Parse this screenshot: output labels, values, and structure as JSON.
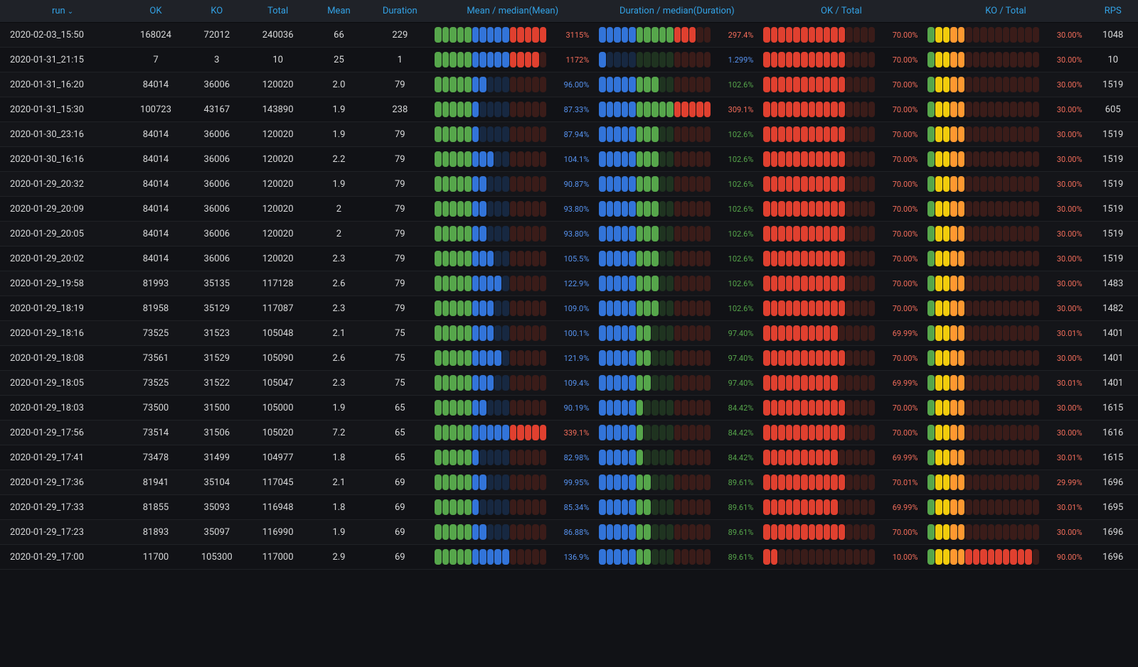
{
  "columns": {
    "run": "run",
    "ok": "OK",
    "ko": "KO",
    "total": "Total",
    "mean": "Mean",
    "duration": "Duration",
    "mean_median": "Mean / median(Mean)",
    "duration_median": "Duration / median(Duration)",
    "ok_total": "OK / Total",
    "ko_total": "KO / Total",
    "rps": "RPS"
  },
  "sort": {
    "column": "run",
    "dir": "desc",
    "caret": "⌄"
  },
  "colors": {
    "green_on": "#56a64b",
    "green_off": "#1f3320",
    "blue_on": "#3274d9",
    "blue_off": "#172841",
    "red_on": "#e0402f",
    "red_off": "#3a1c19",
    "yellow_on": "#f2cc0c",
    "orange_on": "#ff9830"
  },
  "gauges": {
    "mean_median": {
      "sections": [
        {
          "color": "green",
          "count": 5
        },
        {
          "color": "blue",
          "count": 5
        },
        {
          "color": "red",
          "count": 5
        }
      ]
    },
    "duration_median": {
      "sections": [
        {
          "color": "blue",
          "count": 5
        },
        {
          "color": "green",
          "count": 5
        },
        {
          "color": "red",
          "count": 5
        }
      ]
    },
    "ok_total": {
      "sections": [
        {
          "color": "red",
          "count": 15
        }
      ]
    },
    "ko_total": {
      "sections": [
        {
          "color": "green",
          "count": 1
        },
        {
          "color": "yellow",
          "count": 2
        },
        {
          "color": "orange",
          "count": 2
        },
        {
          "color": "red",
          "count": 10
        }
      ]
    }
  },
  "rows": [
    {
      "run": "2020-02-03_15:50",
      "ok": "168024",
      "ko": "72012",
      "total": "240036",
      "mean": "66",
      "duration": "229",
      "mean_median": {
        "pct": "3115%",
        "filled": 15,
        "cls": "pct-red"
      },
      "duration_median": {
        "pct": "297.4%",
        "filled": 13,
        "cls": "pct-red"
      },
      "ok_total": {
        "pct": "70.00%",
        "filled": 11,
        "cls": "pct-red"
      },
      "ko_total": {
        "pct": "30.00%",
        "filled": 5,
        "cls": "pct-red"
      },
      "rps": "1048"
    },
    {
      "run": "2020-01-31_21:15",
      "ok": "7",
      "ko": "3",
      "total": "10",
      "mean": "25",
      "duration": "1",
      "mean_median": {
        "pct": "1172%",
        "filled": 14,
        "cls": "pct-red"
      },
      "duration_median": {
        "pct": "1.299%",
        "filled": 1,
        "cls": "pct-blue"
      },
      "ok_total": {
        "pct": "70.00%",
        "filled": 11,
        "cls": "pct-red"
      },
      "ko_total": {
        "pct": "30.00%",
        "filled": 5,
        "cls": "pct-red"
      },
      "rps": "10"
    },
    {
      "run": "2020-01-31_16:20",
      "ok": "84014",
      "ko": "36006",
      "total": "120020",
      "mean": "2.0",
      "duration": "79",
      "mean_median": {
        "pct": "96.00%",
        "filled": 7,
        "cls": "pct-blue"
      },
      "duration_median": {
        "pct": "102.6%",
        "filled": 8,
        "cls": "pct-green"
      },
      "ok_total": {
        "pct": "70.00%",
        "filled": 11,
        "cls": "pct-red"
      },
      "ko_total": {
        "pct": "30.00%",
        "filled": 5,
        "cls": "pct-red"
      },
      "rps": "1519"
    },
    {
      "run": "2020-01-31_15:30",
      "ok": "100723",
      "ko": "43167",
      "total": "143890",
      "mean": "1.9",
      "duration": "238",
      "mean_median": {
        "pct": "87.33%",
        "filled": 6,
        "cls": "pct-blue"
      },
      "duration_median": {
        "pct": "309.1%",
        "filled": 15,
        "cls": "pct-red"
      },
      "ok_total": {
        "pct": "70.00%",
        "filled": 11,
        "cls": "pct-red"
      },
      "ko_total": {
        "pct": "30.00%",
        "filled": 5,
        "cls": "pct-red"
      },
      "rps": "605"
    },
    {
      "run": "2020-01-30_23:16",
      "ok": "84014",
      "ko": "36006",
      "total": "120020",
      "mean": "1.9",
      "duration": "79",
      "mean_median": {
        "pct": "87.94%",
        "filled": 6,
        "cls": "pct-blue"
      },
      "duration_median": {
        "pct": "102.6%",
        "filled": 8,
        "cls": "pct-green"
      },
      "ok_total": {
        "pct": "70.00%",
        "filled": 11,
        "cls": "pct-red"
      },
      "ko_total": {
        "pct": "30.00%",
        "filled": 5,
        "cls": "pct-red"
      },
      "rps": "1519"
    },
    {
      "run": "2020-01-30_16:16",
      "ok": "84014",
      "ko": "36006",
      "total": "120020",
      "mean": "2.2",
      "duration": "79",
      "mean_median": {
        "pct": "104.1%",
        "filled": 8,
        "cls": "pct-blue"
      },
      "duration_median": {
        "pct": "102.6%",
        "filled": 8,
        "cls": "pct-green"
      },
      "ok_total": {
        "pct": "70.00%",
        "filled": 11,
        "cls": "pct-red"
      },
      "ko_total": {
        "pct": "30.00%",
        "filled": 5,
        "cls": "pct-red"
      },
      "rps": "1519"
    },
    {
      "run": "2020-01-29_20:32",
      "ok": "84014",
      "ko": "36006",
      "total": "120020",
      "mean": "1.9",
      "duration": "79",
      "mean_median": {
        "pct": "90.87%",
        "filled": 7,
        "cls": "pct-blue"
      },
      "duration_median": {
        "pct": "102.6%",
        "filled": 8,
        "cls": "pct-green"
      },
      "ok_total": {
        "pct": "70.00%",
        "filled": 11,
        "cls": "pct-red"
      },
      "ko_total": {
        "pct": "30.00%",
        "filled": 5,
        "cls": "pct-red"
      },
      "rps": "1519"
    },
    {
      "run": "2020-01-29_20:09",
      "ok": "84014",
      "ko": "36006",
      "total": "120020",
      "mean": "2",
      "duration": "79",
      "mean_median": {
        "pct": "93.80%",
        "filled": 7,
        "cls": "pct-blue"
      },
      "duration_median": {
        "pct": "102.6%",
        "filled": 8,
        "cls": "pct-green"
      },
      "ok_total": {
        "pct": "70.00%",
        "filled": 11,
        "cls": "pct-red"
      },
      "ko_total": {
        "pct": "30.00%",
        "filled": 5,
        "cls": "pct-red"
      },
      "rps": "1519"
    },
    {
      "run": "2020-01-29_20:05",
      "ok": "84014",
      "ko": "36006",
      "total": "120020",
      "mean": "2",
      "duration": "79",
      "mean_median": {
        "pct": "93.80%",
        "filled": 7,
        "cls": "pct-blue"
      },
      "duration_median": {
        "pct": "102.6%",
        "filled": 8,
        "cls": "pct-green"
      },
      "ok_total": {
        "pct": "70.00%",
        "filled": 11,
        "cls": "pct-red"
      },
      "ko_total": {
        "pct": "30.00%",
        "filled": 5,
        "cls": "pct-red"
      },
      "rps": "1519"
    },
    {
      "run": "2020-01-29_20:02",
      "ok": "84014",
      "ko": "36006",
      "total": "120020",
      "mean": "2.3",
      "duration": "79",
      "mean_median": {
        "pct": "105.5%",
        "filled": 8,
        "cls": "pct-blue"
      },
      "duration_median": {
        "pct": "102.6%",
        "filled": 8,
        "cls": "pct-green"
      },
      "ok_total": {
        "pct": "70.00%",
        "filled": 11,
        "cls": "pct-red"
      },
      "ko_total": {
        "pct": "30.00%",
        "filled": 5,
        "cls": "pct-red"
      },
      "rps": "1519"
    },
    {
      "run": "2020-01-29_19:58",
      "ok": "81993",
      "ko": "35135",
      "total": "117128",
      "mean": "2.6",
      "duration": "79",
      "mean_median": {
        "pct": "122.9%",
        "filled": 9,
        "cls": "pct-blue"
      },
      "duration_median": {
        "pct": "102.6%",
        "filled": 8,
        "cls": "pct-green"
      },
      "ok_total": {
        "pct": "70.00%",
        "filled": 11,
        "cls": "pct-red"
      },
      "ko_total": {
        "pct": "30.00%",
        "filled": 5,
        "cls": "pct-red"
      },
      "rps": "1483"
    },
    {
      "run": "2020-01-29_18:19",
      "ok": "81958",
      "ko": "35129",
      "total": "117087",
      "mean": "2.3",
      "duration": "79",
      "mean_median": {
        "pct": "109.0%",
        "filled": 8,
        "cls": "pct-blue"
      },
      "duration_median": {
        "pct": "102.6%",
        "filled": 8,
        "cls": "pct-green"
      },
      "ok_total": {
        "pct": "70.00%",
        "filled": 11,
        "cls": "pct-red"
      },
      "ko_total": {
        "pct": "30.00%",
        "filled": 5,
        "cls": "pct-red"
      },
      "rps": "1482"
    },
    {
      "run": "2020-01-29_18:16",
      "ok": "73525",
      "ko": "31523",
      "total": "105048",
      "mean": "2.1",
      "duration": "75",
      "mean_median": {
        "pct": "100.1%",
        "filled": 8,
        "cls": "pct-blue"
      },
      "duration_median": {
        "pct": "97.40%",
        "filled": 7,
        "cls": "pct-green"
      },
      "ok_total": {
        "pct": "69.99%",
        "filled": 10,
        "cls": "pct-red"
      },
      "ko_total": {
        "pct": "30.01%",
        "filled": 5,
        "cls": "pct-red"
      },
      "rps": "1401"
    },
    {
      "run": "2020-01-29_18:08",
      "ok": "73561",
      "ko": "31529",
      "total": "105090",
      "mean": "2.6",
      "duration": "75",
      "mean_median": {
        "pct": "121.9%",
        "filled": 9,
        "cls": "pct-blue"
      },
      "duration_median": {
        "pct": "97.40%",
        "filled": 7,
        "cls": "pct-green"
      },
      "ok_total": {
        "pct": "70.00%",
        "filled": 11,
        "cls": "pct-red"
      },
      "ko_total": {
        "pct": "30.00%",
        "filled": 5,
        "cls": "pct-red"
      },
      "rps": "1401"
    },
    {
      "run": "2020-01-29_18:05",
      "ok": "73525",
      "ko": "31522",
      "total": "105047",
      "mean": "2.3",
      "duration": "75",
      "mean_median": {
        "pct": "109.4%",
        "filled": 8,
        "cls": "pct-blue"
      },
      "duration_median": {
        "pct": "97.40%",
        "filled": 7,
        "cls": "pct-green"
      },
      "ok_total": {
        "pct": "69.99%",
        "filled": 10,
        "cls": "pct-red"
      },
      "ko_total": {
        "pct": "30.01%",
        "filled": 5,
        "cls": "pct-red"
      },
      "rps": "1401"
    },
    {
      "run": "2020-01-29_18:03",
      "ok": "73500",
      "ko": "31500",
      "total": "105000",
      "mean": "1.9",
      "duration": "65",
      "mean_median": {
        "pct": "90.19%",
        "filled": 7,
        "cls": "pct-blue"
      },
      "duration_median": {
        "pct": "84.42%",
        "filled": 6,
        "cls": "pct-green"
      },
      "ok_total": {
        "pct": "70.00%",
        "filled": 11,
        "cls": "pct-red"
      },
      "ko_total": {
        "pct": "30.00%",
        "filled": 5,
        "cls": "pct-red"
      },
      "rps": "1615"
    },
    {
      "run": "2020-01-29_17:56",
      "ok": "73514",
      "ko": "31506",
      "total": "105020",
      "mean": "7.2",
      "duration": "65",
      "mean_median": {
        "pct": "339.1%",
        "filled": 15,
        "cls": "pct-red"
      },
      "duration_median": {
        "pct": "84.42%",
        "filled": 6,
        "cls": "pct-green"
      },
      "ok_total": {
        "pct": "70.00%",
        "filled": 11,
        "cls": "pct-red"
      },
      "ko_total": {
        "pct": "30.00%",
        "filled": 5,
        "cls": "pct-red"
      },
      "rps": "1616"
    },
    {
      "run": "2020-01-29_17:41",
      "ok": "73478",
      "ko": "31499",
      "total": "104977",
      "mean": "1.8",
      "duration": "65",
      "mean_median": {
        "pct": "82.98%",
        "filled": 6,
        "cls": "pct-blue"
      },
      "duration_median": {
        "pct": "84.42%",
        "filled": 6,
        "cls": "pct-green"
      },
      "ok_total": {
        "pct": "69.99%",
        "filled": 10,
        "cls": "pct-red"
      },
      "ko_total": {
        "pct": "30.01%",
        "filled": 5,
        "cls": "pct-red"
      },
      "rps": "1615"
    },
    {
      "run": "2020-01-29_17:36",
      "ok": "81941",
      "ko": "35104",
      "total": "117045",
      "mean": "2.1",
      "duration": "69",
      "mean_median": {
        "pct": "99.95%",
        "filled": 7,
        "cls": "pct-blue"
      },
      "duration_median": {
        "pct": "89.61%",
        "filled": 7,
        "cls": "pct-green"
      },
      "ok_total": {
        "pct": "70.01%",
        "filled": 11,
        "cls": "pct-red"
      },
      "ko_total": {
        "pct": "29.99%",
        "filled": 5,
        "cls": "pct-red"
      },
      "rps": "1696"
    },
    {
      "run": "2020-01-29_17:33",
      "ok": "81855",
      "ko": "35093",
      "total": "116948",
      "mean": "1.8",
      "duration": "69",
      "mean_median": {
        "pct": "85.34%",
        "filled": 6,
        "cls": "pct-blue"
      },
      "duration_median": {
        "pct": "89.61%",
        "filled": 7,
        "cls": "pct-green"
      },
      "ok_total": {
        "pct": "69.99%",
        "filled": 10,
        "cls": "pct-red"
      },
      "ko_total": {
        "pct": "30.01%",
        "filled": 5,
        "cls": "pct-red"
      },
      "rps": "1695"
    },
    {
      "run": "2020-01-29_17:23",
      "ok": "81893",
      "ko": "35097",
      "total": "116990",
      "mean": "1.9",
      "duration": "69",
      "mean_median": {
        "pct": "86.88%",
        "filled": 7,
        "cls": "pct-blue"
      },
      "duration_median": {
        "pct": "89.61%",
        "filled": 7,
        "cls": "pct-green"
      },
      "ok_total": {
        "pct": "70.00%",
        "filled": 11,
        "cls": "pct-red"
      },
      "ko_total": {
        "pct": "30.00%",
        "filled": 5,
        "cls": "pct-red"
      },
      "rps": "1696"
    },
    {
      "run": "2020-01-29_17:00",
      "ok": "11700",
      "ko": "105300",
      "total": "117000",
      "mean": "2.9",
      "duration": "69",
      "mean_median": {
        "pct": "136.9%",
        "filled": 10,
        "cls": "pct-blue"
      },
      "duration_median": {
        "pct": "89.61%",
        "filled": 7,
        "cls": "pct-green"
      },
      "ok_total": {
        "pct": "10.00%",
        "filled": 2,
        "cls": "pct-red"
      },
      "ko_total": {
        "pct": "90.00%",
        "filled": 14,
        "cls": "pct-red"
      },
      "rps": "1696"
    }
  ]
}
